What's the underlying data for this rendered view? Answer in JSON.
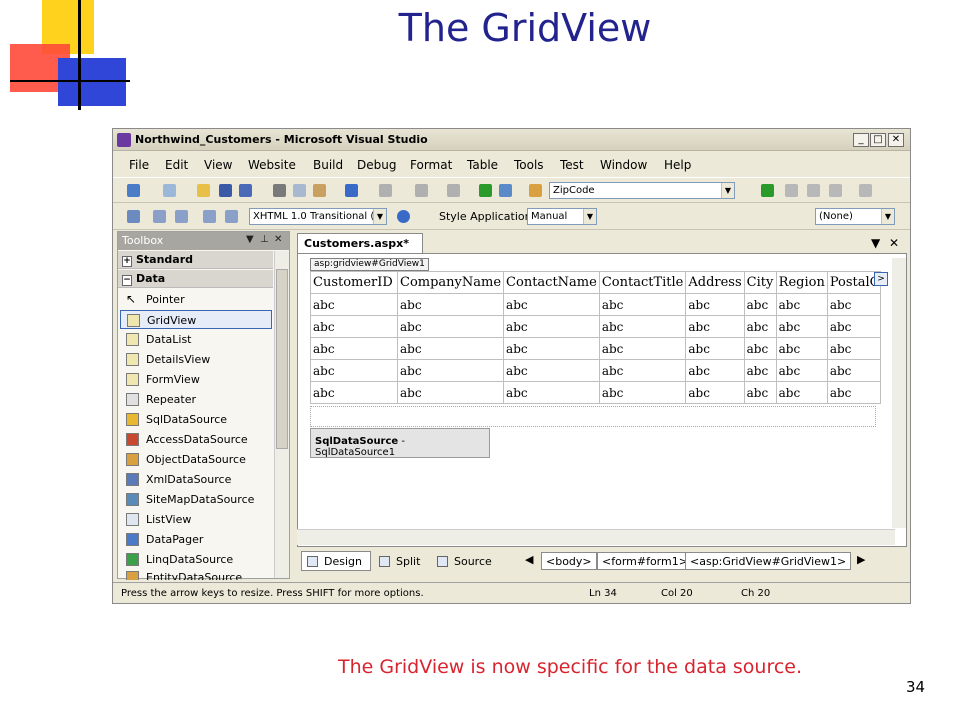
{
  "slide": {
    "title": "The GridView",
    "caption": "The GridView is now specific for the data source.",
    "page_number": "34"
  },
  "window": {
    "title": "Northwind_Customers - Microsoft Visual Studio",
    "minimize": "_",
    "maximize": "□",
    "close": "✕"
  },
  "menu": [
    "File",
    "Edit",
    "View",
    "Website",
    "Build",
    "Debug",
    "Format",
    "Table",
    "Tools",
    "Test",
    "Window",
    "Help"
  ],
  "toolbar": {
    "target_dropdown": "ZipCode",
    "doctype_dropdown": "XHTML 1.0 Transitional (",
    "style_application_label": "Style Application:",
    "style_application_value": "Manual",
    "style_dropdown": "(None)"
  },
  "toolbox": {
    "title": "Toolbox",
    "groups": [
      {
        "label": "Standard",
        "expander": "+"
      },
      {
        "label": "Data",
        "expander": "−"
      }
    ],
    "items": [
      "Pointer",
      "GridView",
      "DataList",
      "DetailsView",
      "FormView",
      "Repeater",
      "SqlDataSource",
      "AccessDataSource",
      "ObjectDataSource",
      "XmlDataSource",
      "SiteMapDataSource",
      "ListView",
      "DataPager",
      "LinqDataSource",
      "EntityDataSource"
    ],
    "selected": "GridView"
  },
  "designer": {
    "doc_tab": "Customers.aspx*",
    "gridview_tag": "asp:gridview#GridView1",
    "columns": [
      "CustomerID",
      "CompanyName",
      "ContactName",
      "ContactTitle",
      "Address",
      "City",
      "Region",
      "PostalC"
    ],
    "rows": [
      [
        "abc",
        "abc",
        "abc",
        "abc",
        "abc",
        "abc",
        "abc",
        "abc"
      ],
      [
        "abc",
        "abc",
        "abc",
        "abc",
        "abc",
        "abc",
        "abc",
        "abc"
      ],
      [
        "abc",
        "abc",
        "abc",
        "abc",
        "abc",
        "abc",
        "abc",
        "abc"
      ],
      [
        "abc",
        "abc",
        "abc",
        "abc",
        "abc",
        "abc",
        "abc",
        "abc"
      ],
      [
        "abc",
        "abc",
        "abc",
        "abc",
        "abc",
        "abc",
        "abc",
        "abc"
      ]
    ],
    "datasource_control_type": "SqlDataSource",
    "datasource_control_id": " - SqlDataSource1",
    "smart_tag": ">"
  },
  "viewbar": {
    "tabs": [
      "Design",
      "Split",
      "Source"
    ],
    "active_tab": "Design",
    "breadcrumbs": [
      "<body>",
      "<form#form1>",
      "<asp:GridView#GridView1>"
    ]
  },
  "statusbar": {
    "message": "Press the arrow keys to resize. Press SHIFT for more options.",
    "line": "Ln 34",
    "column": "Col 20",
    "char": "Ch 20"
  }
}
